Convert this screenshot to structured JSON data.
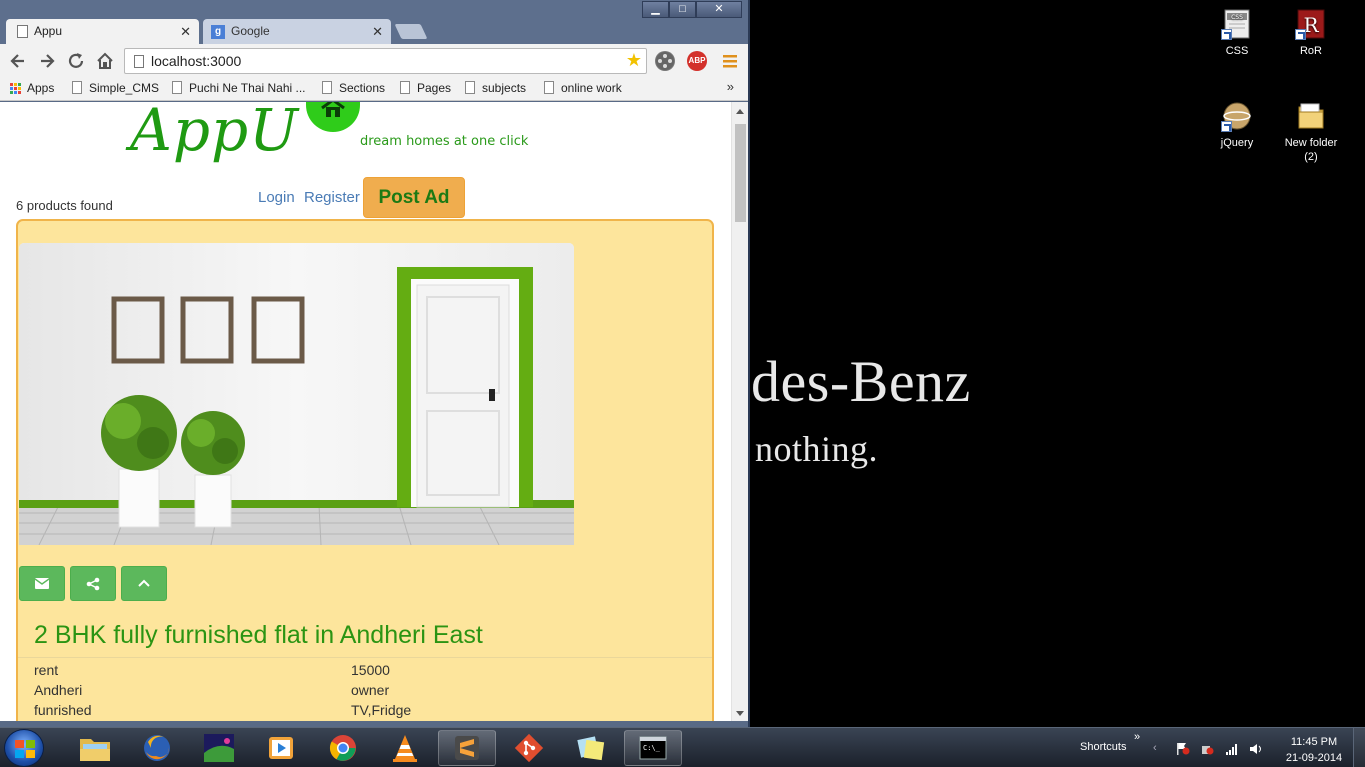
{
  "wallpaper": {
    "line1": "des-Benz",
    "line2": "nothing."
  },
  "desktop_icons": [
    {
      "label": "CSS",
      "icon": "css-shortcut-icon"
    },
    {
      "label": "RoR",
      "icon": "ruby-on-rails-shortcut-icon"
    },
    {
      "label": "jQuery",
      "icon": "jquery-shortcut-icon"
    },
    {
      "label": "New folder (2)",
      "icon": "folder-icon"
    }
  ],
  "browser": {
    "tabs": [
      {
        "title": "Appu",
        "active": true
      },
      {
        "title": "Google",
        "active": false
      }
    ],
    "window_buttons": {
      "minimize": "▁",
      "maximize": "□",
      "close": "✕"
    },
    "url": "localhost:3000",
    "bookmarks": [
      "Apps",
      "Simple_CMS",
      "Puchi Ne Thai Nahi ...",
      "Sections",
      "Pages",
      "subjects",
      "online work"
    ],
    "bookmarks_more": "»",
    "extensions": {
      "abp": "ABP"
    }
  },
  "page": {
    "logo": "AppU",
    "tagline": "dream homes at one click",
    "products_found": "6 products found",
    "login": "Login",
    "register": "Register",
    "post_ad": "Post Ad",
    "listing": {
      "title": "2 BHK fully furnished flat in Andheri East",
      "details": [
        [
          "rent",
          "15000"
        ],
        [
          "Andheri",
          "owner"
        ],
        [
          "funrished",
          "TV,Fridge"
        ]
      ]
    }
  },
  "taskbar": {
    "apps": [
      "file-explorer",
      "firefox",
      "media-app",
      "media-player",
      "chrome",
      "vlc",
      "sublime-text",
      "git",
      "sticky-notes",
      "command-prompt"
    ],
    "shortcuts_label": "Shortcuts",
    "time": "11:45 PM",
    "date": "21-09-2014"
  },
  "colors": {
    "brand_green": "#1f9a12",
    "post_ad_orange": "#f0ad4e",
    "card_bg": "#fde59c",
    "action_green": "#5cb85c"
  }
}
